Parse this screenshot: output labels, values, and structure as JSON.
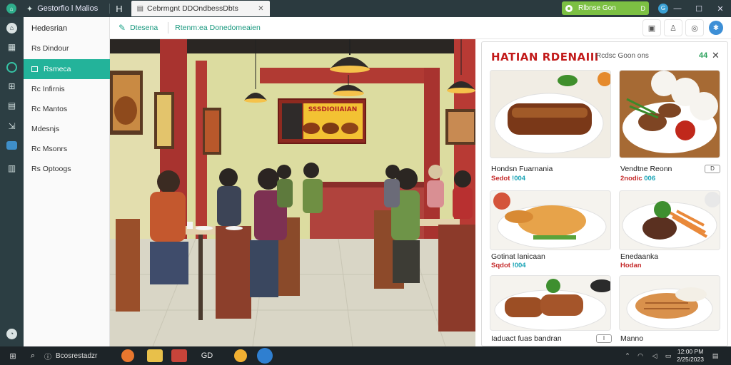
{
  "titlebar": {
    "app_title": "Gestorfio l Malios",
    "h_glyph": "H",
    "tab_label": "Cebrmgnt DDOndbessDbts",
    "status_label": "Rlbnse Gon",
    "status_flag": "D",
    "globe": "G",
    "minimize": "—",
    "maximize": "☐",
    "close": "✕"
  },
  "rail": {
    "icons": [
      "home-icon",
      "grid-icon",
      "globe-icon",
      "apps-icon",
      "document-icon",
      "arrow-icon",
      "square-icon",
      "table-icon",
      "settings-icon"
    ]
  },
  "nav": {
    "header": "Hedesrian",
    "items": [
      {
        "label": "Rs Dindour"
      },
      {
        "label": "Rsmeca"
      },
      {
        "label": "Rc Infirnis"
      },
      {
        "label": "Rc Mantos"
      },
      {
        "label": "Mdesnjs"
      },
      {
        "label": "Rc Msonrs"
      },
      {
        "label": "Rs Optoogs"
      }
    ]
  },
  "toolbar": {
    "primary": "Dtesena",
    "breadcrumb": "Rtenm:ea Donedomeaien",
    "icons": [
      "image-icon",
      "person-icon",
      "chart-icon",
      "globe-icon"
    ]
  },
  "scene": {
    "menu_board_title": "SSSDIOIIAIAN"
  },
  "panel": {
    "title": "HATIAN RDENAIII",
    "subtitle": "Rcdsc Goon ons",
    "count": "44",
    "close": "✕",
    "cards": [
      {
        "name": "Hondsn Fuarnania",
        "price_red": "Sedot",
        "price_teal": "!004",
        "add": ""
      },
      {
        "name": "Vendtne Reonn",
        "price_red": "2nodic",
        "price_teal": "006",
        "add": "D"
      },
      {
        "name": "Gotinat lanicaan",
        "price_red": "Sqdot",
        "price_teal": "!004",
        "add": ""
      },
      {
        "name": "Enedaanka",
        "price_red": "Hodan",
        "price_teal": "",
        "add": ""
      },
      {
        "name": "Iaduact fuas bandran",
        "price_red": "",
        "price_teal": "",
        "add": "I"
      },
      {
        "name": "Manno",
        "price_red": "",
        "price_teal": "",
        "add": ""
      }
    ]
  },
  "taskbar": {
    "search": "Bcosrestadzr",
    "center_label": "GD",
    "clock_time": "12:00 PM",
    "clock_date": "2/25/2023"
  },
  "colors": {
    "accent": "#23b39a",
    "title_red": "#c21a1a",
    "status_green": "#7cc043"
  }
}
